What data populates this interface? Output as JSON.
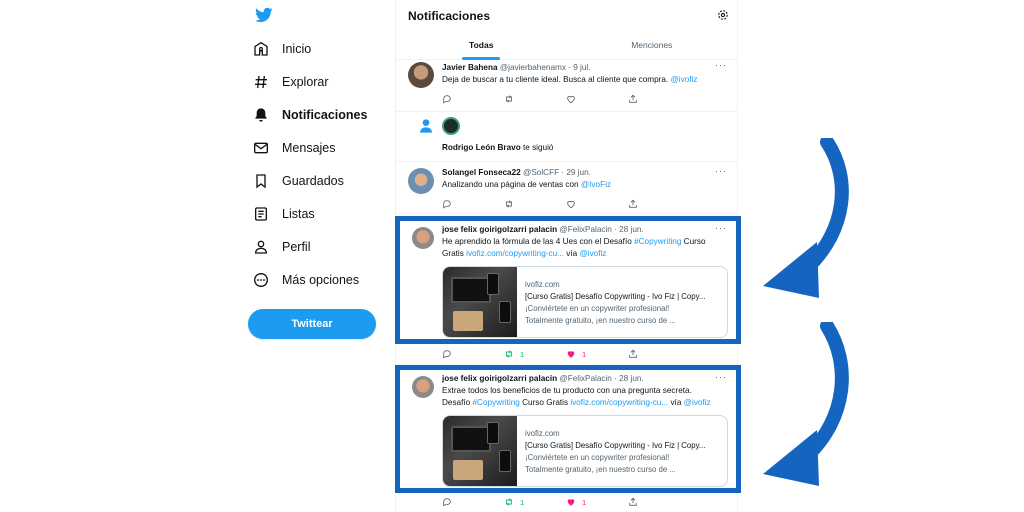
{
  "sidebar": {
    "items": [
      {
        "label": "Inicio",
        "icon": "home-icon"
      },
      {
        "label": "Explorar",
        "icon": "hashtag-icon"
      },
      {
        "label": "Notificaciones",
        "icon": "bell-icon"
      },
      {
        "label": "Mensajes",
        "icon": "envelope-icon"
      },
      {
        "label": "Guardados",
        "icon": "bookmark-icon"
      },
      {
        "label": "Listas",
        "icon": "list-icon"
      },
      {
        "label": "Perfil",
        "icon": "person-icon"
      },
      {
        "label": "Más opciones",
        "icon": "more-options-icon"
      }
    ],
    "tweet_button": "Twittear"
  },
  "header": {
    "title": "Notificaciones"
  },
  "tabs": [
    {
      "label": "Todas"
    },
    {
      "label": "Menciones"
    }
  ],
  "notifications": {
    "n1": {
      "name": "Javier Bahena",
      "meta": "@javierbahenamx · 9 jul.",
      "text": "Deja de buscar a tu cliente ideal. Busca al cliente que compra. ",
      "mention": "@ivofiz"
    },
    "n2": {
      "name": "Rodrigo León Bravo",
      "text": " te siguió"
    },
    "n3": {
      "name": "Solangel Fonseca22",
      "meta": "@SolCFF · 29 jun.",
      "text": "Analizando una página de ventas con ",
      "mention": "@IvoFiz"
    },
    "n4": {
      "name": "jose felix goirigolzarri palacin",
      "meta": "@FelixPalacin · 28 jun.",
      "line1": "He aprendido la fórmula de las 4 Ues con el Desafío ",
      "hashtag": "#Copywriting",
      "line1b": " Curso",
      "line2a": "Gratis ",
      "url": "ivofiz.com/copywriting-cu...",
      "via": " vía ",
      "mention": "@ivofiz",
      "card": {
        "domain": "ivofiz.com",
        "title": "[Curso Gratis] Desafío Copywriting - Ivo Fiz | Copy...",
        "desc1": "¡Conviértete en un copywriter profesional!",
        "desc2": "Totalmente gratuito, ¡en nuestro curso de ..."
      },
      "retweets": "1",
      "likes": "1"
    },
    "n5": {
      "name": "jose felix goirigolzarri palacin",
      "meta": "@FelixPalacin · 28 jun.",
      "line1": "Extrae todos los beneficios de tu producto con una pregunta secreta.",
      "line2a": "Desafío ",
      "hashtag": "#Copywriting",
      "line2b": " Curso Gratis ",
      "url": "ivofiz.com/copywriting-cu...",
      "via": " vía ",
      "mention": "@ivofiz",
      "card": {
        "domain": "ivofiz.com",
        "title": "[Curso Gratis] Desafío Copywriting - Ivo Fiz | Copy...",
        "desc1": "¡Conviértete en un copywriter profesional!",
        "desc2": "Totalmente gratuito, ¡en nuestro curso de ..."
      },
      "retweets": "1",
      "likes": "1"
    }
  },
  "colors": {
    "accent": "#1d9bf0",
    "highlight": "#1565c0",
    "retweet": "#00ba7c",
    "like": "#f91880"
  }
}
